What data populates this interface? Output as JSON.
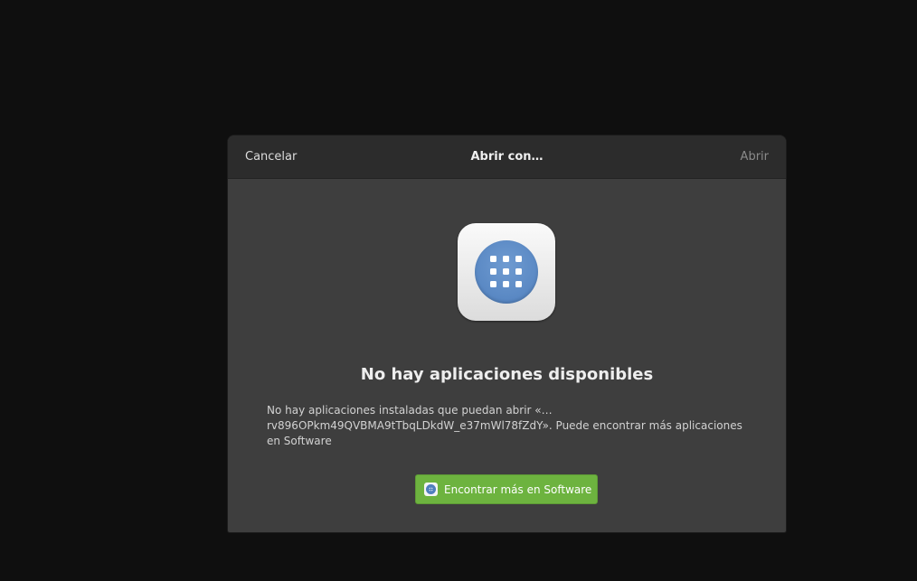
{
  "dialog": {
    "title": "Abrir con…",
    "cancel_label": "Cancelar",
    "open_label": "Abrir",
    "icon": "app-grid-icon",
    "heading": "No hay aplicaciones disponibles",
    "message": "No hay aplicaciones instaladas que puedan abrir «…rv896OPkm49QVBMA9tTbqLDkdW_e37mWl78fZdY». Puede encontrar más aplicaciones en Software",
    "find_button_label": "Encontrar más en Software",
    "find_button_icon": "software-icon"
  },
  "colors": {
    "background": "#0f0f0f",
    "dialog_body": "#3e3e3e",
    "headerbar": "#2c2c2c",
    "accent_button": "#6db33f",
    "icon_circle": "#5583c1"
  }
}
